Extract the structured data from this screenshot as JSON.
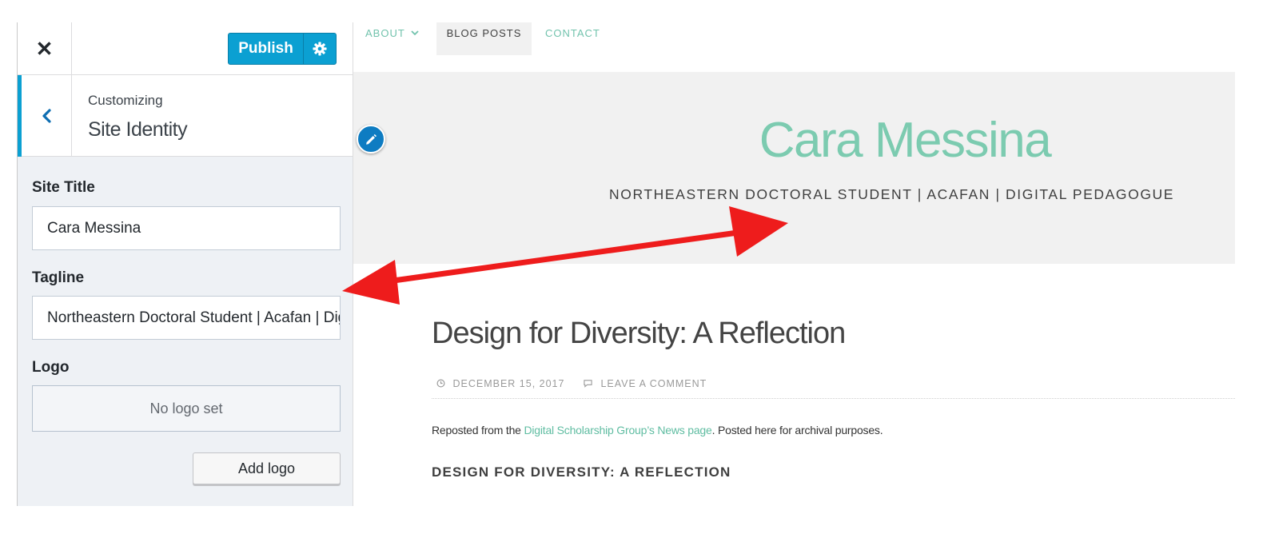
{
  "customizer": {
    "close_glyph": "✕",
    "publish_label": "Publish",
    "section_kicker": "Customizing",
    "section_title": "Site Identity",
    "site_title_label": "Site Title",
    "site_title_value": "Cara Messina",
    "tagline_label": "Tagline",
    "tagline_value": "Northeastern Doctoral Student | Acafan | Digital Pedagogue",
    "logo_label": "Logo",
    "no_logo_text": "No logo set",
    "add_logo_label": "Add logo"
  },
  "preview": {
    "nav": {
      "about": "ABOUT",
      "blog_posts": "BLOG POSTS",
      "contact": "CONTACT"
    },
    "site_title": "Cara Messina",
    "site_tagline": "NORTHEASTERN DOCTORAL STUDENT | ACAFAN | DIGITAL PEDAGOGUE",
    "post": {
      "title": "Design for Diversity: A Reflection",
      "date": "DECEMBER 15, 2017",
      "comment_link": "LEAVE A COMMENT",
      "body_before": "Reposted from the ",
      "body_link": "Digital Scholarship Group’s News page",
      "body_after": ". Posted here for archival purposes.",
      "subheading": "DESIGN FOR DIVERSITY: A REFLECTION"
    }
  },
  "colors": {
    "accent_blue": "#0ba0d2",
    "site_green": "#7ccbb0",
    "annotation_red": "#ee1c1c"
  },
  "icons": [
    "close-icon",
    "gear-icon",
    "chevron-left-icon",
    "chevron-down-icon",
    "pencil-icon",
    "clock-icon",
    "comment-icon",
    "double-headed-arrow"
  ]
}
